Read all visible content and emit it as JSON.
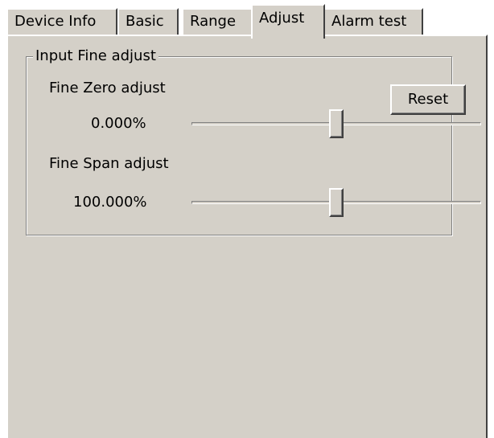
{
  "tabs": [
    {
      "label": "Device Info",
      "active": false
    },
    {
      "label": "Basic",
      "active": false
    },
    {
      "label": "Range",
      "active": false
    },
    {
      "label": "Adjust",
      "active": true
    },
    {
      "label": "Alarm test",
      "active": false
    }
  ],
  "group": {
    "title": "Input Fine adjust",
    "reset_label": "Reset",
    "zero": {
      "label": "Fine Zero adjust",
      "value_text": "0.000%",
      "slider_position": 0.5
    },
    "span": {
      "label": "Fine Span adjust",
      "value_text": "100.000%",
      "slider_position": 0.5
    }
  },
  "colors": {
    "face": "#d4d0c8",
    "highlight": "#ffffff",
    "shadow": "#808080",
    "dark_shadow": "#404040"
  }
}
